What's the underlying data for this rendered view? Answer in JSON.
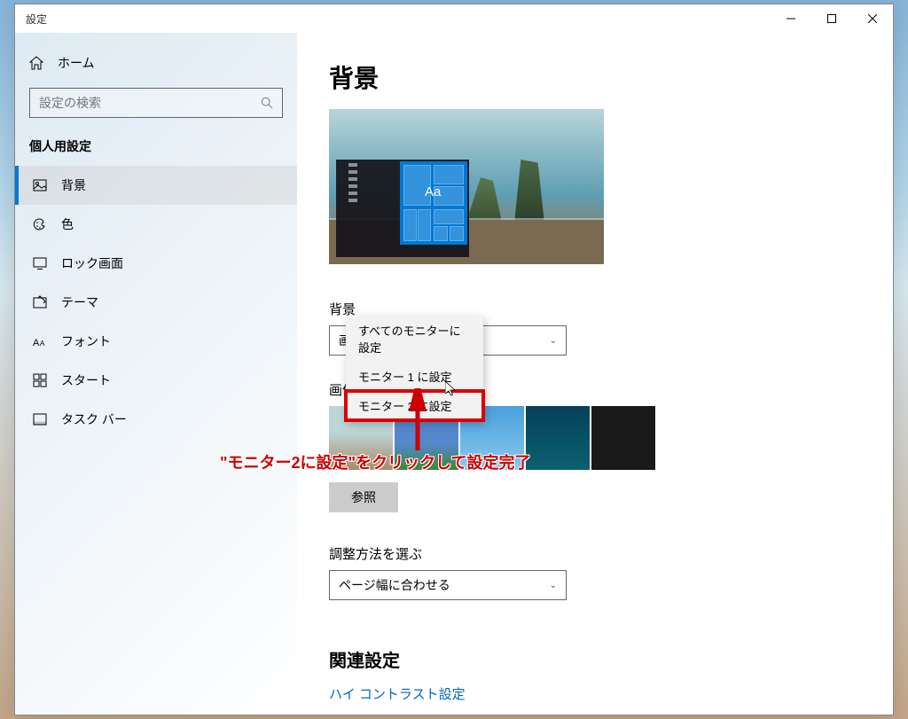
{
  "titlebar": {
    "title": "設定"
  },
  "sidebar": {
    "home": "ホーム",
    "search_placeholder": "設定の検索",
    "section": "個人用設定",
    "items": [
      {
        "label": "背景"
      },
      {
        "label": "色"
      },
      {
        "label": "ロック画面"
      },
      {
        "label": "テーマ"
      },
      {
        "label": "フォント"
      },
      {
        "label": "スタート"
      },
      {
        "label": "タスク バー"
      }
    ]
  },
  "main": {
    "title": "背景",
    "preview_aa": "Aa",
    "bg_label": "背景",
    "bg_dropdown": "画像",
    "choose_label": "画像を選んでください",
    "browse": "参照",
    "fit_label": "調整方法を選ぶ",
    "fit_dropdown": "ページ幅に合わせる",
    "related_title": "関連設定",
    "related_link": "ハイ コントラスト設定"
  },
  "context_menu": {
    "items": [
      "すべてのモニターに設定",
      "モニター 1 に設定",
      "モニター 2 に設定"
    ]
  },
  "annotation": {
    "text": "\"モニター2に設定\"をクリックして設定完了"
  }
}
